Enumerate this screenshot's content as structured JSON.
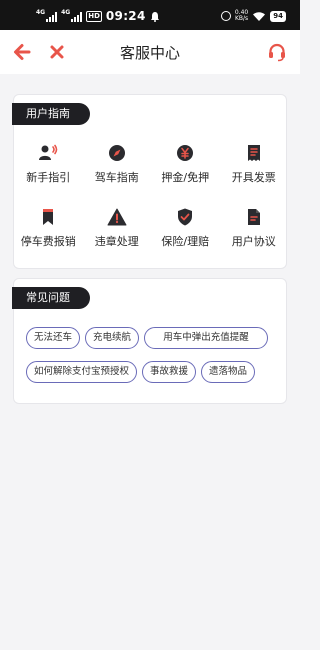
{
  "status_bar": {
    "net1": "4G",
    "net2": "4G",
    "hd": "HD",
    "time": "09:24",
    "speed_value": "0.40",
    "speed_unit": "KB/s",
    "battery": "94"
  },
  "header": {
    "title": "客服中心",
    "icons": {
      "back": "arrow-left-icon",
      "close": "close-icon",
      "support": "headset-icon"
    },
    "accent_color": "#e8554a"
  },
  "guide": {
    "title": "用户指南",
    "items": [
      {
        "label": "新手指引",
        "icon": "user-voice-icon"
      },
      {
        "label": "驾车指南",
        "icon": "compass-icon"
      },
      {
        "label": "押金/免押",
        "icon": "yuan-coin-icon"
      },
      {
        "label": "开具发票",
        "icon": "invoice-icon"
      },
      {
        "label": "停车费报销",
        "icon": "bookmark-icon"
      },
      {
        "label": "违章处理",
        "icon": "warning-icon"
      },
      {
        "label": "保险/理赔",
        "icon": "shield-check-icon"
      },
      {
        "label": "用户协议",
        "icon": "document-icon"
      }
    ]
  },
  "faq": {
    "title": "常见问题",
    "chips": [
      [
        "无法还车",
        "充电续航",
        "用车中弹出充值提醒"
      ],
      [
        "如何解除支付宝预授权",
        "事故救援",
        "遗落物品"
      ]
    ],
    "chip_border_color": "#6a6bb8"
  },
  "colors": {
    "icon_dark": "#2b2b2f",
    "icon_red": "#e8554a",
    "tag_bg": "#1f1f23"
  }
}
